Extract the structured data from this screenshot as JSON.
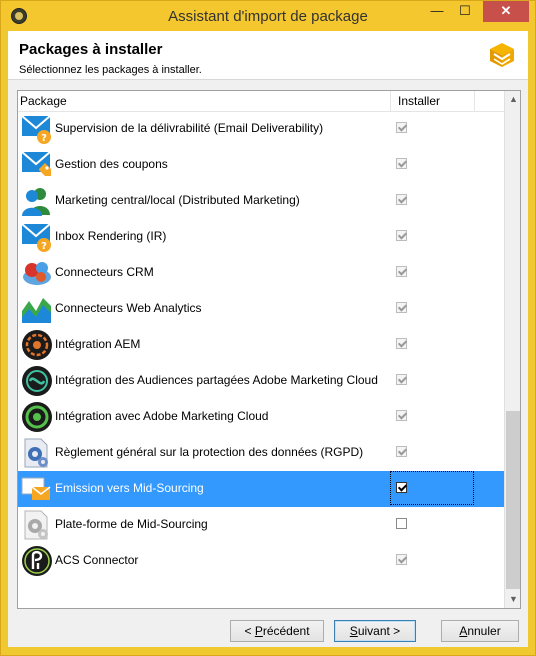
{
  "window": {
    "title": "Assistant d'import de package",
    "minimize": "—",
    "maximize": "☐",
    "close": "✕"
  },
  "header": {
    "title": "Packages à installer",
    "subtitle": "Sélectionnez les packages à installer."
  },
  "list": {
    "columns": {
      "package": "Package",
      "install": "Installer"
    },
    "rows": [
      {
        "label": "Supervision de la délivrabilité (Email Deliverability)",
        "icon": "envelope-question-icon",
        "checked": true,
        "enabled": false,
        "selected": false
      },
      {
        "label": "Gestion des coupons",
        "icon": "envelope-coupon-icon",
        "checked": true,
        "enabled": false,
        "selected": false
      },
      {
        "label": "Marketing central/local (Distributed Marketing)",
        "icon": "users-icon",
        "checked": true,
        "enabled": false,
        "selected": false
      },
      {
        "label": "Inbox Rendering (IR)",
        "icon": "envelope-question-icon",
        "checked": true,
        "enabled": false,
        "selected": false
      },
      {
        "label": "Connecteurs CRM",
        "icon": "crm-connectors-icon",
        "checked": true,
        "enabled": false,
        "selected": false
      },
      {
        "label": "Connecteurs Web Analytics",
        "icon": "web-analytics-icon",
        "checked": true,
        "enabled": false,
        "selected": false
      },
      {
        "label": "Intégration AEM",
        "icon": "aem-icon",
        "checked": true,
        "enabled": false,
        "selected": false
      },
      {
        "label": "Intégration des Audiences partagées Adobe Marketing Cloud",
        "icon": "shared-audiences-icon",
        "checked": true,
        "enabled": false,
        "selected": false
      },
      {
        "label": "Intégration avec Adobe Marketing Cloud",
        "icon": "marketing-cloud-icon",
        "checked": true,
        "enabled": false,
        "selected": false
      },
      {
        "label": "Règlement général sur la protection des données (RGPD)",
        "icon": "gdpr-gear-icon",
        "checked": true,
        "enabled": false,
        "selected": false
      },
      {
        "label": "Emission vers Mid-Sourcing",
        "icon": "mid-sourcing-emission-icon",
        "checked": true,
        "enabled": true,
        "selected": true
      },
      {
        "label": "Plate-forme de Mid-Sourcing",
        "icon": "mid-sourcing-platform-icon",
        "checked": false,
        "enabled": true,
        "selected": false
      },
      {
        "label": "ACS Connector",
        "icon": "acs-connector-icon",
        "checked": true,
        "enabled": false,
        "selected": false
      }
    ]
  },
  "buttons": {
    "previous": {
      "mnemonic": "P",
      "pre": "< ",
      "rest": "récédent"
    },
    "next": {
      "mnemonic": "S",
      "rest": "uivant >"
    },
    "cancel": {
      "mnemonic": "A",
      "rest": "nnuler"
    }
  },
  "scrollbar": {
    "up": "▲",
    "down": "▼"
  },
  "colors": {
    "title_bar": "#f3c72d",
    "selection": "#3399ff",
    "close_button": "#c7504a"
  }
}
